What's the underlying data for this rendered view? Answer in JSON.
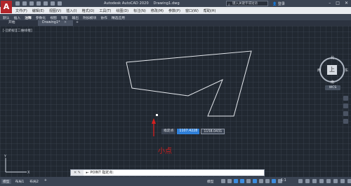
{
  "titlebar": {
    "logo": "A",
    "app_name": "Autodesk AutoCAD 2020",
    "file_name": "Drawing1.dwg",
    "search_placeholder": "键入关键字或短语",
    "user": "登录"
  },
  "menu": [
    "文件(F)",
    "编辑(E)",
    "视图(V)",
    "插入(I)",
    "格式(O)",
    "工具(T)",
    "绘图(D)",
    "标注(N)",
    "修改(M)",
    "参数(P)",
    "窗口(W)",
    "帮助(H)"
  ],
  "ribbon_tabs": [
    "默认",
    "插入",
    "注释",
    "参数化",
    "视图",
    "管理",
    "输出",
    "附加模块",
    "协作",
    "精选应用"
  ],
  "ribbon_active": 2,
  "doc_tabs": {
    "start": "开始",
    "drawing": "Drawing1*",
    "close": "×",
    "add": "+"
  },
  "viewport_label": "[-][俯视][二维线框]",
  "viewcube": {
    "face": "上",
    "n": "北",
    "s": "南",
    "w": "西",
    "e": "东",
    "wcs": "WCS"
  },
  "tooltip": {
    "label": "指定点",
    "value_x": "1107.4228",
    "value_y": "1158.0431"
  },
  "annotation": "小点",
  "command": {
    "icon": "✕ ✎",
    "text": "▸- POINT 指定点:"
  },
  "status": {
    "layout_tabs": [
      "模型",
      "布局1",
      "布局2",
      "+"
    ],
    "model_label": "模型",
    "scale": "1:1",
    "ucs_x": "X",
    "ucs_y": "Y"
  },
  "colors": {
    "canvas": "#212831",
    "annotation_red": "#d61f1f",
    "logo_red": "#b3262b",
    "accent_blue": "#2f7fd8"
  }
}
